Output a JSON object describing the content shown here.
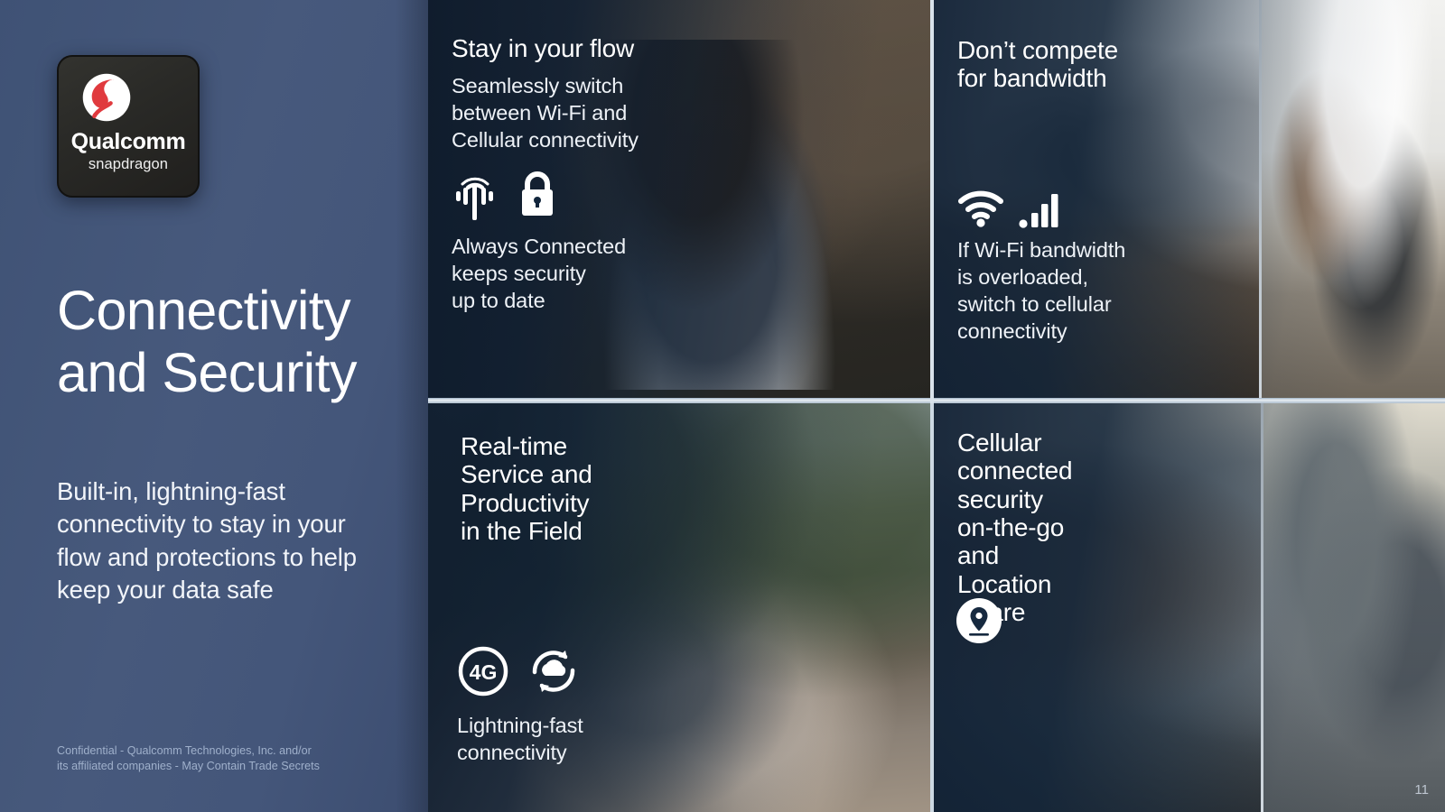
{
  "sidebar": {
    "logo": {
      "swirl_icon": "snapdragon-swirl-icon",
      "brand": "Qualcomm",
      "product": "snapdragon",
      "badge_color": "#272623",
      "swirl_red": "#e03a3e"
    },
    "title_line1": "Connectivity",
    "title_line2": "and Security",
    "subtitle": "Built-in, lightning-fast connectivity to stay in your flow and protections to help keep your data safe",
    "footnote_line1": "Confidential - Qualcomm Technologies, Inc. and/or",
    "footnote_line2": "its affiliated companies - May Contain Trade Secrets",
    "background_color": "#44567a"
  },
  "panels": [
    {
      "id": "stay-in-your-flow",
      "heading": "Stay in your flow",
      "body_line1": "Seamlessly switch",
      "body_line2": "between Wi-Fi and",
      "body_line3": "Cellular connectivity",
      "icons": [
        "cell-tower-icon",
        "padlock-icon"
      ],
      "caption_line1": "Always Connected",
      "caption_line2": "keeps security",
      "caption_line3": "up to date",
      "photo": "man-with-headphones-on-laptop-in-cafe"
    },
    {
      "id": "dont-compete-for-bandwidth",
      "heading_line1": "Don’t compete",
      "heading_line2": "for bandwidth",
      "icons": [
        "wifi-icon",
        "signal-bars-icon"
      ],
      "caption_line1": "If Wi-Fi bandwidth",
      "caption_line2": "is overloaded,",
      "caption_line3": "switch to cellular",
      "caption_line4": "connectivity",
      "photo": "family-on-laptops-at-home-kitchen-table"
    },
    {
      "id": "real-time-service-and-productivity",
      "heading_line1": "Real-time",
      "heading_line2": "Service and",
      "heading_line3": "Productivity",
      "heading_line4": "in the Field",
      "icons": [
        "4g-badge-icon",
        "cloud-sync-icon"
      ],
      "caption_line1": "Lightning-fast",
      "caption_line2": "connectivity",
      "photo": "service-technician-with-tablet-and-family-outdoors"
    },
    {
      "id": "cellular-connected-security",
      "heading_line1": "Cellular",
      "heading_line2": "connected",
      "heading_line3": "security",
      "heading_line4": "on-the-go",
      "heading_line5": "and",
      "heading_line6": "Location",
      "heading_line7": "aware",
      "icons": [
        "location-pin-icon"
      ],
      "photo": "children-with-laptop-in-vehicle-back-seat"
    }
  ],
  "page_number": "11"
}
